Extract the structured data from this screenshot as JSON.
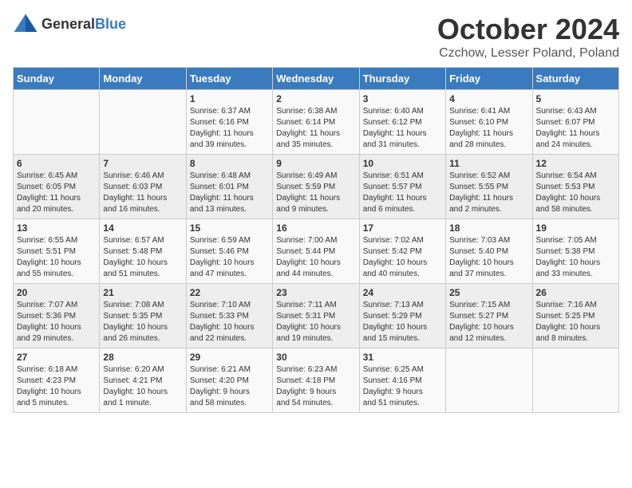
{
  "logo": {
    "general": "General",
    "blue": "Blue"
  },
  "title": "October 2024",
  "location": "Czchow, Lesser Poland, Poland",
  "days_header": [
    "Sunday",
    "Monday",
    "Tuesday",
    "Wednesday",
    "Thursday",
    "Friday",
    "Saturday"
  ],
  "weeks": [
    [
      {
        "day": "",
        "content": ""
      },
      {
        "day": "",
        "content": ""
      },
      {
        "day": "1",
        "content": "Sunrise: 6:37 AM\nSunset: 6:16 PM\nDaylight: 11 hours\nand 39 minutes."
      },
      {
        "day": "2",
        "content": "Sunrise: 6:38 AM\nSunset: 6:14 PM\nDaylight: 11 hours\nand 35 minutes."
      },
      {
        "day": "3",
        "content": "Sunrise: 6:40 AM\nSunset: 6:12 PM\nDaylight: 11 hours\nand 31 minutes."
      },
      {
        "day": "4",
        "content": "Sunrise: 6:41 AM\nSunset: 6:10 PM\nDaylight: 11 hours\nand 28 minutes."
      },
      {
        "day": "5",
        "content": "Sunrise: 6:43 AM\nSunset: 6:07 PM\nDaylight: 11 hours\nand 24 minutes."
      }
    ],
    [
      {
        "day": "6",
        "content": "Sunrise: 6:45 AM\nSunset: 6:05 PM\nDaylight: 11 hours\nand 20 minutes."
      },
      {
        "day": "7",
        "content": "Sunrise: 6:46 AM\nSunset: 6:03 PM\nDaylight: 11 hours\nand 16 minutes."
      },
      {
        "day": "8",
        "content": "Sunrise: 6:48 AM\nSunset: 6:01 PM\nDaylight: 11 hours\nand 13 minutes."
      },
      {
        "day": "9",
        "content": "Sunrise: 6:49 AM\nSunset: 5:59 PM\nDaylight: 11 hours\nand 9 minutes."
      },
      {
        "day": "10",
        "content": "Sunrise: 6:51 AM\nSunset: 5:57 PM\nDaylight: 11 hours\nand 6 minutes."
      },
      {
        "day": "11",
        "content": "Sunrise: 6:52 AM\nSunset: 5:55 PM\nDaylight: 11 hours\nand 2 minutes."
      },
      {
        "day": "12",
        "content": "Sunrise: 6:54 AM\nSunset: 5:53 PM\nDaylight: 10 hours\nand 58 minutes."
      }
    ],
    [
      {
        "day": "13",
        "content": "Sunrise: 6:55 AM\nSunset: 5:51 PM\nDaylight: 10 hours\nand 55 minutes."
      },
      {
        "day": "14",
        "content": "Sunrise: 6:57 AM\nSunset: 5:48 PM\nDaylight: 10 hours\nand 51 minutes."
      },
      {
        "day": "15",
        "content": "Sunrise: 6:59 AM\nSunset: 5:46 PM\nDaylight: 10 hours\nand 47 minutes."
      },
      {
        "day": "16",
        "content": "Sunrise: 7:00 AM\nSunset: 5:44 PM\nDaylight: 10 hours\nand 44 minutes."
      },
      {
        "day": "17",
        "content": "Sunrise: 7:02 AM\nSunset: 5:42 PM\nDaylight: 10 hours\nand 40 minutes."
      },
      {
        "day": "18",
        "content": "Sunrise: 7:03 AM\nSunset: 5:40 PM\nDaylight: 10 hours\nand 37 minutes."
      },
      {
        "day": "19",
        "content": "Sunrise: 7:05 AM\nSunset: 5:38 PM\nDaylight: 10 hours\nand 33 minutes."
      }
    ],
    [
      {
        "day": "20",
        "content": "Sunrise: 7:07 AM\nSunset: 5:36 PM\nDaylight: 10 hours\nand 29 minutes."
      },
      {
        "day": "21",
        "content": "Sunrise: 7:08 AM\nSunset: 5:35 PM\nDaylight: 10 hours\nand 26 minutes."
      },
      {
        "day": "22",
        "content": "Sunrise: 7:10 AM\nSunset: 5:33 PM\nDaylight: 10 hours\nand 22 minutes."
      },
      {
        "day": "23",
        "content": "Sunrise: 7:11 AM\nSunset: 5:31 PM\nDaylight: 10 hours\nand 19 minutes."
      },
      {
        "day": "24",
        "content": "Sunrise: 7:13 AM\nSunset: 5:29 PM\nDaylight: 10 hours\nand 15 minutes."
      },
      {
        "day": "25",
        "content": "Sunrise: 7:15 AM\nSunset: 5:27 PM\nDaylight: 10 hours\nand 12 minutes."
      },
      {
        "day": "26",
        "content": "Sunrise: 7:16 AM\nSunset: 5:25 PM\nDaylight: 10 hours\nand 8 minutes."
      }
    ],
    [
      {
        "day": "27",
        "content": "Sunrise: 6:18 AM\nSunset: 4:23 PM\nDaylight: 10 hours\nand 5 minutes."
      },
      {
        "day": "28",
        "content": "Sunrise: 6:20 AM\nSunset: 4:21 PM\nDaylight: 10 hours\nand 1 minute."
      },
      {
        "day": "29",
        "content": "Sunrise: 6:21 AM\nSunset: 4:20 PM\nDaylight: 9 hours\nand 58 minutes."
      },
      {
        "day": "30",
        "content": "Sunrise: 6:23 AM\nSunset: 4:18 PM\nDaylight: 9 hours\nand 54 minutes."
      },
      {
        "day": "31",
        "content": "Sunrise: 6:25 AM\nSunset: 4:16 PM\nDaylight: 9 hours\nand 51 minutes."
      },
      {
        "day": "",
        "content": ""
      },
      {
        "day": "",
        "content": ""
      }
    ]
  ]
}
